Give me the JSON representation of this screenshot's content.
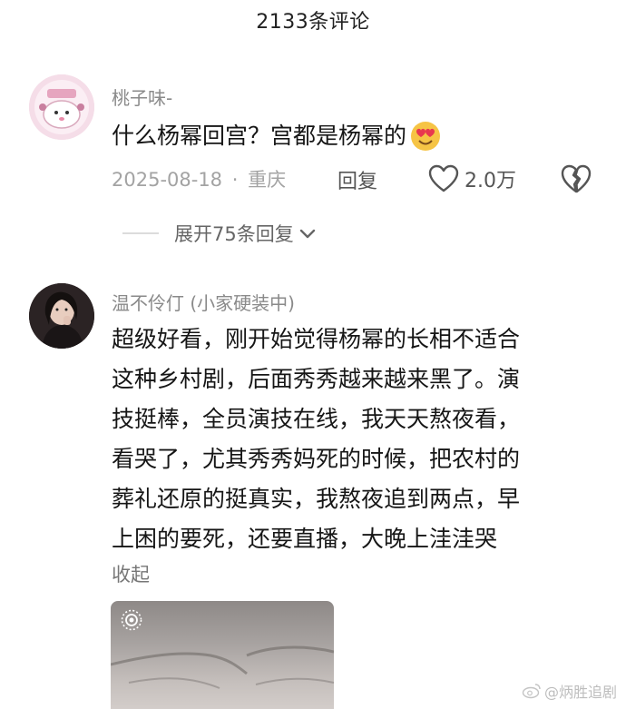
{
  "header": {
    "title": "2133条评论"
  },
  "comments": [
    {
      "username": "桃子味-",
      "content_lines": [
        "什么杨幂回宫？宫都是杨幂的"
      ],
      "date": "2025-08-18",
      "separator": "·",
      "location": "重庆",
      "reply_label": "回复",
      "likes": "2.0万",
      "expand_label": "展开75条回复"
    },
    {
      "username": "温不伶仃 (小家硬装中)",
      "content_lines": [
        "超级好看，刚开始觉得杨幂的长相不适合",
        "这种乡村剧，后面秀秀越来越来黑了。演",
        "技挺棒，全员演技在线，我天天熬夜看，",
        "看哭了，尤其秀秀妈死的时候，把农村的",
        "葬礼还原的挺真实，我熬夜追到两点，早",
        "上困的要死，还要直播，大晚上洼洼哭"
      ],
      "collapse_label": "收起"
    }
  ],
  "watermark": "@炳胜追剧",
  "icons": {
    "like": "heart-outline-icon",
    "dislike": "broken-heart-icon",
    "expand": "chevron-down-icon",
    "media": "live-photo-icon",
    "emoji": "heart-eyes-emoji",
    "watermark": "weibo-logo-icon"
  },
  "colors": {
    "meta_text": "#a3a3a3",
    "username_text": "#8a8a8a",
    "content_text": "#161616"
  }
}
